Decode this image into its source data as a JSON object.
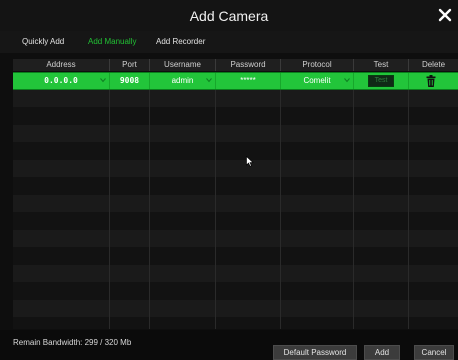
{
  "window": {
    "title": "Add Camera",
    "close_icon": "close-icon"
  },
  "tabs": [
    {
      "label": "Quickly Add",
      "active": false
    },
    {
      "label": "Add Manually",
      "active": true
    },
    {
      "label": "Add Recorder",
      "active": false
    }
  ],
  "table": {
    "columns": [
      "Address",
      "Port",
      "Username",
      "Password",
      "Protocol",
      "Test",
      "Delete"
    ],
    "rows": [
      {
        "address": "0.0.0.0",
        "port": "9008",
        "username": "admin",
        "password": "*****",
        "protocol": "Comelit",
        "test_label": "Test",
        "delete_icon": "trash-icon"
      }
    ]
  },
  "footer": {
    "bandwidth": "Remain Bandwidth: 299 / 320 Mb",
    "default_password_label": "Default Password",
    "add_label": "Add",
    "cancel_label": "Cancel"
  },
  "colors": {
    "accent": "#22c53a",
    "background": "#0e0e0e"
  }
}
